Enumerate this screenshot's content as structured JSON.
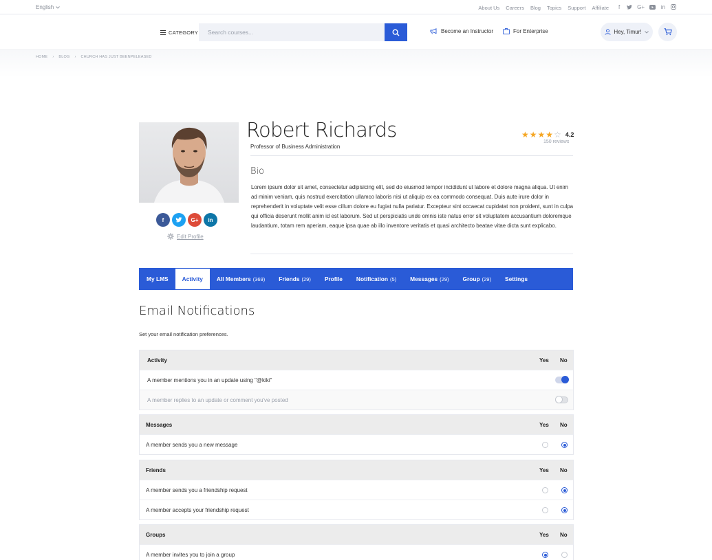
{
  "topbar": {
    "language": "English",
    "links": [
      "About Us",
      "Careers",
      "Blog",
      "Topics",
      "Support",
      "Affiliate"
    ],
    "social_icons": [
      "facebook-icon",
      "twitter-icon",
      "google-plus-icon",
      "youtube-icon",
      "linkedin-icon",
      "instagram-icon"
    ]
  },
  "header": {
    "category_label": "CATEGORY",
    "search_placeholder": "Search courses...",
    "instructor_label": "Become an Instructor",
    "enterprise_label": "For Enterprise",
    "user_greeting": "Hey, Timur!"
  },
  "breadcrumb": [
    "HOME",
    "BLOG",
    "CHURCH HAS JUST BEENPELEASED"
  ],
  "profile": {
    "name": "Robert Richards",
    "title": "Professor of Business Administration",
    "rating_value": "4.2",
    "rating_stars": 4,
    "reviews": "150 reviews",
    "bio_heading": "Bio",
    "bio": "Lorem ipsum dolor sit amet, consectetur adipisicing elit, sed do eiusmod tempor incididunt ut labore et dolore magna aliqua. Ut enim ad minim veniam, quis nostrud exercitation ullamco laboris nisi ut aliquip ex ea commodo consequat. Duis aute irure dolor in reprehenderit in voluptate velit esse cillum dolore eu fugiat nulla pariatur. Excepteur sint occaecat cupidatat non proident, sunt in culpa qui officia deserunt mollit anim id est laborum. Sed ut perspiciatis unde omnis iste natus error sit voluptatem accusantium doloremque laudantium, totam rem aperiam, eaque ipsa quae ab illo inventore veritatis et quasi architecto beatae vitae dicta sunt explicabo.",
    "edit_label": "Edit Profile",
    "social": [
      "f",
      "t",
      "G+",
      "in"
    ]
  },
  "tabs": [
    {
      "label": "My LMS",
      "count": ""
    },
    {
      "label": "Activity",
      "count": "",
      "active": true
    },
    {
      "label": "All Members",
      "count": "(369)"
    },
    {
      "label": "Friends",
      "count": "(29)"
    },
    {
      "label": "Profile",
      "count": ""
    },
    {
      "label": "Notification",
      "count": "(5)"
    },
    {
      "label": "Messages",
      "count": "(29)"
    },
    {
      "label": "Group",
      "count": "(29)"
    },
    {
      "label": "Settings",
      "count": ""
    }
  ],
  "email": {
    "heading": "Email Notifications",
    "subtitle": "Set your email notification preferences.",
    "yes_label": "Yes",
    "no_label": "No",
    "groups": [
      {
        "title": "Activity",
        "rows": [
          {
            "label": "A member mentions you in an update using \"@kiki\"",
            "control": "toggle",
            "enabled": true
          },
          {
            "label": "A member replies to an update or comment you've posted",
            "control": "toggle",
            "enabled": false
          }
        ]
      },
      {
        "title": "Messages",
        "rows": [
          {
            "label": "A member sends you a new message",
            "control": "radio",
            "selected": "no"
          }
        ]
      },
      {
        "title": "Friends",
        "rows": [
          {
            "label": "A member sends you a friendship request",
            "control": "radio",
            "selected": "no"
          },
          {
            "label": "A member accepts your friendship request",
            "control": "radio",
            "selected": "no"
          }
        ]
      },
      {
        "title": "Groups",
        "rows": [
          {
            "label": "A member invites you to join a group",
            "control": "radio",
            "selected": "yes"
          }
        ]
      }
    ]
  },
  "colors": {
    "accent": "#2a5bd7",
    "star": "#f5a623",
    "facebook": "#3b5998",
    "twitter": "#1da1f2",
    "google": "#dd4b39",
    "linkedin": "#0e76a8"
  }
}
